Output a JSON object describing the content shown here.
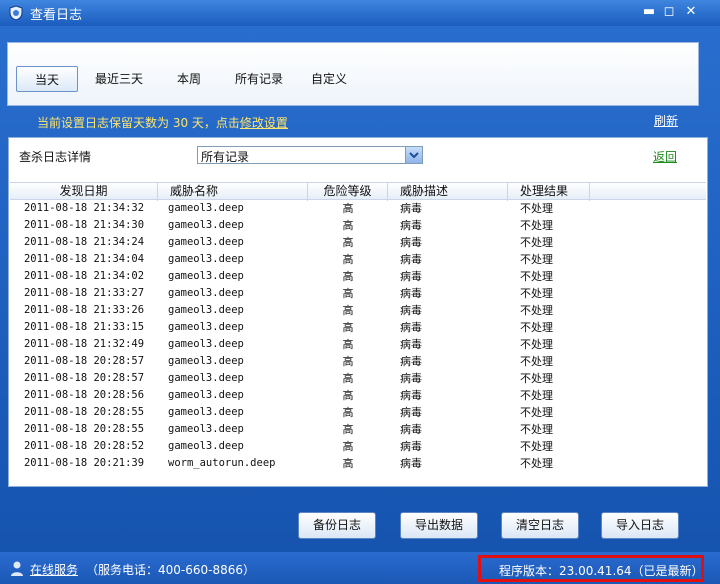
{
  "window": {
    "title": "查看日志"
  },
  "title_buttons": {
    "minimize": "▬",
    "maximize": "◻",
    "close": "✕"
  },
  "tabs": [
    {
      "label": "当天",
      "active": true
    },
    {
      "label": "最近三天",
      "active": false
    },
    {
      "label": "本周",
      "active": false
    },
    {
      "label": "所有记录",
      "active": false
    },
    {
      "label": "自定义",
      "active": false
    }
  ],
  "info": {
    "prefix": "当前设置日志保留天数为 30 天，点击",
    "link": "修改设置"
  },
  "refresh_label": "刷新",
  "detail": {
    "label": "查杀日志详情",
    "select_value": "所有记录",
    "back_label": "返回"
  },
  "table": {
    "columns": [
      "发现日期",
      "威胁名称",
      "危险等级",
      "威胁描述",
      "处理结果"
    ],
    "rows": [
      [
        "2011-08-18 21:34:32",
        "gameol3.deep",
        "高",
        "病毒",
        "不处理"
      ],
      [
        "2011-08-18 21:34:30",
        "gameol3.deep",
        "高",
        "病毒",
        "不处理"
      ],
      [
        "2011-08-18 21:34:24",
        "gameol3.deep",
        "高",
        "病毒",
        "不处理"
      ],
      [
        "2011-08-18 21:34:04",
        "gameol3.deep",
        "高",
        "病毒",
        "不处理"
      ],
      [
        "2011-08-18 21:34:02",
        "gameol3.deep",
        "高",
        "病毒",
        "不处理"
      ],
      [
        "2011-08-18 21:33:27",
        "gameol3.deep",
        "高",
        "病毒",
        "不处理"
      ],
      [
        "2011-08-18 21:33:26",
        "gameol3.deep",
        "高",
        "病毒",
        "不处理"
      ],
      [
        "2011-08-18 21:33:15",
        "gameol3.deep",
        "高",
        "病毒",
        "不处理"
      ],
      [
        "2011-08-18 21:32:49",
        "gameol3.deep",
        "高",
        "病毒",
        "不处理"
      ],
      [
        "2011-08-18 20:28:57",
        "gameol3.deep",
        "高",
        "病毒",
        "不处理"
      ],
      [
        "2011-08-18 20:28:57",
        "gameol3.deep",
        "高",
        "病毒",
        "不处理"
      ],
      [
        "2011-08-18 20:28:56",
        "gameol3.deep",
        "高",
        "病毒",
        "不处理"
      ],
      [
        "2011-08-18 20:28:55",
        "gameol3.deep",
        "高",
        "病毒",
        "不处理"
      ],
      [
        "2011-08-18 20:28:55",
        "gameol3.deep",
        "高",
        "病毒",
        "不处理"
      ],
      [
        "2011-08-18 20:28:52",
        "gameol3.deep",
        "高",
        "病毒",
        "不处理"
      ],
      [
        "2011-08-18 20:21:39",
        "worm_autorun.deep",
        "高",
        "病毒",
        "不处理"
      ]
    ]
  },
  "buttons": {
    "backup": "备份日志",
    "export": "导出数据",
    "clear": "清空日志",
    "import": "导入日志"
  },
  "status": {
    "online_service": "在线服务",
    "phone": "（服务电话：400-660-8866）",
    "version": "程序版本：23.00.41.64（已是最新）"
  },
  "colors": {
    "window_blue": "#1a5bb8",
    "info_yellow": "#ffe66b",
    "back_green": "#1a8a1a",
    "highlight_red": "#e01010"
  }
}
